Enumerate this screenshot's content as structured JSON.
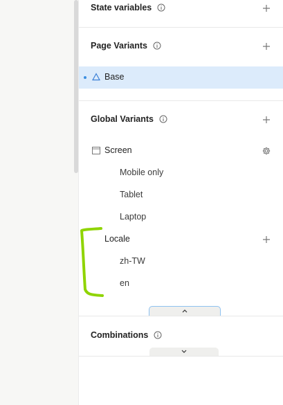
{
  "sections": {
    "state_variables": {
      "title": "State variables"
    },
    "page_variants": {
      "title": "Page Variants",
      "base_label": "Base"
    },
    "global_variants": {
      "title": "Global Variants",
      "screen": {
        "label": "Screen",
        "options": [
          "Mobile only",
          "Tablet",
          "Laptop"
        ]
      },
      "locale": {
        "label": "Locale",
        "options": [
          "zh-TW",
          "en"
        ]
      }
    },
    "combinations": {
      "title": "Combinations"
    }
  },
  "colors": {
    "selected_row_bg": "#dcebfb",
    "accent_blue": "#3b8fe0",
    "annotation_green": "#8fd400"
  },
  "icons": {
    "info": "info-icon",
    "add": "plus-icon",
    "variant": "triangle-icon",
    "screen": "window-icon",
    "settings": "gear-icon",
    "collapse": "chevron-up-icon",
    "expand": "chevron-down-icon"
  }
}
